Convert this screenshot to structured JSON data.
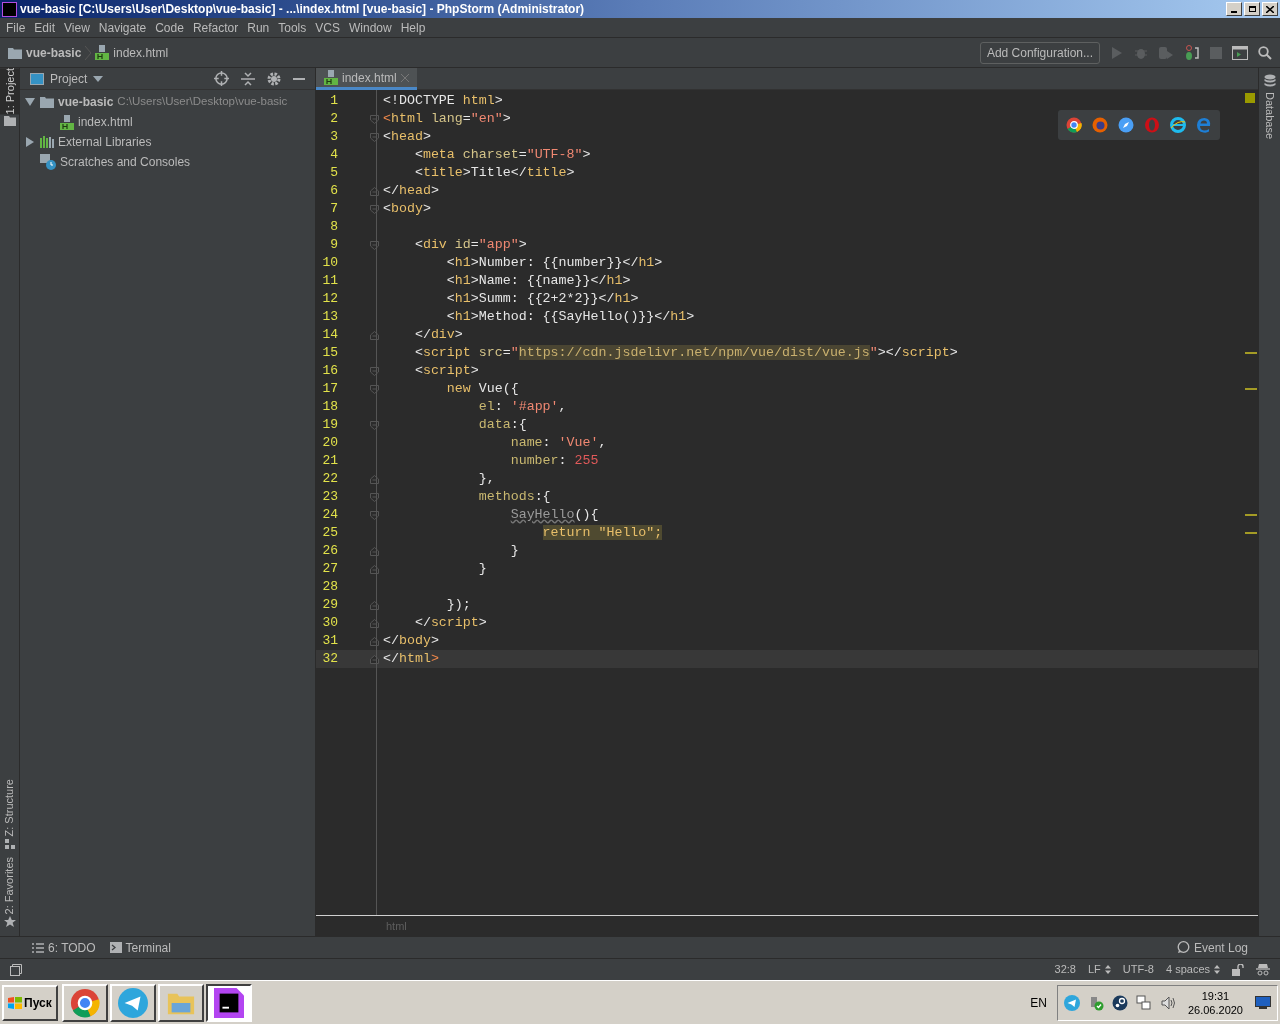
{
  "window": {
    "title": "vue-basic [C:\\Users\\User\\Desktop\\vue-basic] - ...\\index.html [vue-basic] - PhpStorm (Administrator)"
  },
  "menu": [
    "File",
    "Edit",
    "View",
    "Navigate",
    "Code",
    "Refactor",
    "Run",
    "Tools",
    "VCS",
    "Window",
    "Help"
  ],
  "navigation": {
    "breadcrumbs": [
      {
        "label": "vue-basic",
        "kind": "folder"
      },
      {
        "label": "index.html",
        "kind": "html"
      }
    ],
    "run_config": "Add Configuration..."
  },
  "left_stripe": {
    "top": [
      {
        "label": "1: Project",
        "selected": true
      }
    ],
    "bottom": [
      {
        "label": "Z: Structure",
        "selected": false
      },
      {
        "label": "2: Favorites",
        "selected": false
      }
    ]
  },
  "right_stripe": [
    {
      "label": "Database",
      "selected": false
    }
  ],
  "project": {
    "title": "Project",
    "tree": [
      {
        "label": "vue-basic",
        "path": "C:\\Users\\User\\Desktop\\vue-basic",
        "kind": "folder",
        "expanded": true,
        "children": [
          {
            "label": "index.html",
            "kind": "html"
          }
        ]
      },
      {
        "label": "External Libraries",
        "kind": "library",
        "expanded": false
      },
      {
        "label": "Scratches and Consoles",
        "kind": "scratch"
      }
    ]
  },
  "editor": {
    "tabs": [
      {
        "label": "index.html",
        "selected": true
      }
    ],
    "lines": [
      {
        "number": "1",
        "fold_open": false,
        "fold_close": false,
        "warning": false,
        "current": false,
        "tokens": [
          {
            "text": "<!DOCTYPE ",
            "kind": "plain"
          },
          {
            "text": "html",
            "kind": "tag"
          },
          {
            "text": ">",
            "kind": "plain"
          }
        ]
      },
      {
        "number": "2",
        "fold_open": true,
        "fold_close": false,
        "warning": false,
        "current": false,
        "tokens": [
          {
            "text": "<",
            "kind": "error"
          },
          {
            "text": "html",
            "kind": "tag"
          },
          {
            "text": " lang",
            "kind": "attr"
          },
          {
            "text": "=",
            "kind": "plain"
          },
          {
            "text": "\"en\"",
            "kind": "string"
          },
          {
            "text": ">",
            "kind": "plain"
          }
        ]
      },
      {
        "number": "3",
        "fold_open": true,
        "fold_close": false,
        "warning": false,
        "current": false,
        "tokens": [
          {
            "text": "<",
            "kind": "plain"
          },
          {
            "text": "head",
            "kind": "tag"
          },
          {
            "text": ">",
            "kind": "plain"
          }
        ]
      },
      {
        "number": "4",
        "fold_open": false,
        "fold_close": false,
        "warning": false,
        "current": false,
        "tokens": [
          {
            "text": "    <",
            "kind": "plain"
          },
          {
            "text": "meta",
            "kind": "tag"
          },
          {
            "text": " charset",
            "kind": "attr"
          },
          {
            "text": "=",
            "kind": "plain"
          },
          {
            "text": "\"UTF-8\"",
            "kind": "string"
          },
          {
            "text": ">",
            "kind": "plain"
          }
        ]
      },
      {
        "number": "5",
        "fold_open": false,
        "fold_close": false,
        "warning": false,
        "current": false,
        "tokens": [
          {
            "text": "    <",
            "kind": "plain"
          },
          {
            "text": "title",
            "kind": "tag"
          },
          {
            "text": ">Title</",
            "kind": "plain"
          },
          {
            "text": "title",
            "kind": "tag"
          },
          {
            "text": ">",
            "kind": "plain"
          }
        ]
      },
      {
        "number": "6",
        "fold_open": false,
        "fold_close": true,
        "warning": false,
        "current": false,
        "tokens": [
          {
            "text": "</",
            "kind": "plain"
          },
          {
            "text": "head",
            "kind": "tag"
          },
          {
            "text": ">",
            "kind": "plain"
          }
        ]
      },
      {
        "number": "7",
        "fold_open": true,
        "fold_close": false,
        "warning": false,
        "current": false,
        "tokens": [
          {
            "text": "<",
            "kind": "plain"
          },
          {
            "text": "body",
            "kind": "tag"
          },
          {
            "text": ">",
            "kind": "plain"
          }
        ]
      },
      {
        "number": "8",
        "fold_open": false,
        "fold_close": false,
        "warning": false,
        "current": false
      },
      {
        "number": "9",
        "fold_open": true,
        "fold_close": false,
        "warning": false,
        "current": false,
        "tokens": [
          {
            "text": "    <",
            "kind": "plain"
          },
          {
            "text": "div",
            "kind": "tag"
          },
          {
            "text": " id",
            "kind": "attr"
          },
          {
            "text": "=",
            "kind": "plain"
          },
          {
            "text": "\"app\"",
            "kind": "string"
          },
          {
            "text": ">",
            "kind": "plain"
          }
        ]
      },
      {
        "number": "10",
        "fold_open": false,
        "fold_close": false,
        "warning": false,
        "current": false,
        "tokens": [
          {
            "text": "        <",
            "kind": "plain"
          },
          {
            "text": "h1",
            "kind": "tag"
          },
          {
            "text": ">Number: {{number}}</",
            "kind": "plain"
          },
          {
            "text": "h1",
            "kind": "tag"
          },
          {
            "text": ">",
            "kind": "plain"
          }
        ]
      },
      {
        "number": "11",
        "fold_open": false,
        "fold_close": false,
        "warning": false,
        "current": false,
        "tokens": [
          {
            "text": "        <",
            "kind": "plain"
          },
          {
            "text": "h1",
            "kind": "tag"
          },
          {
            "text": ">Name: {{name}}</",
            "kind": "plain"
          },
          {
            "text": "h1",
            "kind": "tag"
          },
          {
            "text": ">",
            "kind": "plain"
          }
        ]
      },
      {
        "number": "12",
        "fold_open": false,
        "fold_close": false,
        "warning": false,
        "current": false,
        "tokens": [
          {
            "text": "        <",
            "kind": "plain"
          },
          {
            "text": "h1",
            "kind": "tag"
          },
          {
            "text": ">Summ: {{2+2*2}}</",
            "kind": "plain"
          },
          {
            "text": "h1",
            "kind": "tag"
          },
          {
            "text": ">",
            "kind": "plain"
          }
        ]
      },
      {
        "number": "13",
        "fold_open": false,
        "fold_close": false,
        "warning": false,
        "current": false,
        "tokens": [
          {
            "text": "        <",
            "kind": "plain"
          },
          {
            "text": "h1",
            "kind": "tag"
          },
          {
            "text": ">Method: {{SayHello()}}</",
            "kind": "plain"
          },
          {
            "text": "h1",
            "kind": "tag"
          },
          {
            "text": ">",
            "kind": "plain"
          }
        ]
      },
      {
        "number": "14",
        "fold_open": false,
        "fold_close": true,
        "warning": false,
        "current": false,
        "tokens": [
          {
            "text": "    </",
            "kind": "plain"
          },
          {
            "text": "div",
            "kind": "tag"
          },
          {
            "text": ">",
            "kind": "plain"
          }
        ]
      },
      {
        "number": "15",
        "fold_open": false,
        "fold_close": false,
        "warning": true,
        "current": false,
        "tokens": [
          {
            "text": "    <",
            "kind": "plain"
          },
          {
            "text": "script",
            "kind": "tag"
          },
          {
            "text": " src",
            "kind": "attr"
          },
          {
            "text": "=",
            "kind": "plain"
          },
          {
            "text": "\"",
            "kind": "string"
          },
          {
            "text": "https://cdn.jsdelivr.net/npm/vue/dist/vue.js",
            "kind": "url"
          },
          {
            "text": "\"",
            "kind": "string"
          },
          {
            "text": "></",
            "kind": "plain"
          },
          {
            "text": "script",
            "kind": "tag"
          },
          {
            "text": ">",
            "kind": "plain"
          }
        ]
      },
      {
        "number": "16",
        "fold_open": true,
        "fold_close": false,
        "warning": false,
        "current": false,
        "tokens": [
          {
            "text": "    <",
            "kind": "plain"
          },
          {
            "text": "script",
            "kind": "tag"
          },
          {
            "text": ">",
            "kind": "plain"
          }
        ]
      },
      {
        "number": "17",
        "fold_open": true,
        "fold_close": false,
        "warning": true,
        "current": false,
        "tokens": [
          {
            "text": "        new",
            "kind": "keyword"
          },
          {
            "text": " Vue({",
            "kind": "plain"
          }
        ]
      },
      {
        "number": "18",
        "fold_open": false,
        "fold_close": false,
        "warning": false,
        "current": false,
        "tokens": [
          {
            "text": "            el",
            "kind": "prop"
          },
          {
            "text": ": ",
            "kind": "plain"
          },
          {
            "text": "'#app'",
            "kind": "string"
          },
          {
            "text": ",",
            "kind": "plain"
          }
        ]
      },
      {
        "number": "19",
        "fold_open": true,
        "fold_close": false,
        "warning": false,
        "current": false,
        "tokens": [
          {
            "text": "            data",
            "kind": "prop"
          },
          {
            "text": ":{",
            "kind": "plain"
          }
        ]
      },
      {
        "number": "20",
        "fold_open": false,
        "fold_close": false,
        "warning": false,
        "current": false,
        "tokens": [
          {
            "text": "                name",
            "kind": "prop"
          },
          {
            "text": ": ",
            "kind": "plain"
          },
          {
            "text": "'Vue'",
            "kind": "string"
          },
          {
            "text": ",",
            "kind": "plain"
          }
        ]
      },
      {
        "number": "21",
        "fold_open": false,
        "fold_close": false,
        "warning": false,
        "current": false,
        "tokens": [
          {
            "text": "                number",
            "kind": "prop"
          },
          {
            "text": ": ",
            "kind": "plain"
          },
          {
            "text": "255",
            "kind": "number"
          }
        ]
      },
      {
        "number": "22",
        "fold_open": false,
        "fold_close": true,
        "warning": false,
        "current": false,
        "tokens": [
          {
            "text": "            },",
            "kind": "plain"
          }
        ]
      },
      {
        "number": "23",
        "fold_open": true,
        "fold_close": false,
        "warning": false,
        "current": false,
        "tokens": [
          {
            "text": "            methods",
            "kind": "prop"
          },
          {
            "text": ":{",
            "kind": "plain"
          }
        ]
      },
      {
        "number": "24",
        "fold_open": true,
        "fold_close": false,
        "warning": true,
        "current": false,
        "tokens": [
          {
            "text": "                SayHello",
            "kind": "unused"
          },
          {
            "text": "(){",
            "kind": "plain"
          }
        ]
      },
      {
        "number": "25",
        "fold_open": false,
        "fold_close": false,
        "warning": true,
        "current": false,
        "tokens": [
          {
            "text": "                    return \"Hello\";",
            "kind": "highlight"
          }
        ]
      },
      {
        "number": "26",
        "fold_open": false,
        "fold_close": true,
        "warning": false,
        "current": false,
        "tokens": [
          {
            "text": "                }",
            "kind": "plain"
          }
        ]
      },
      {
        "number": "27",
        "fold_open": false,
        "fold_close": true,
        "warning": false,
        "current": false,
        "tokens": [
          {
            "text": "            }",
            "kind": "plain"
          }
        ]
      },
      {
        "number": "28",
        "fold_open": false,
        "fold_close": false,
        "warning": false,
        "current": false
      },
      {
        "number": "29",
        "fold_open": false,
        "fold_close": true,
        "warning": false,
        "current": false,
        "tokens": [
          {
            "text": "        });",
            "kind": "plain"
          }
        ]
      },
      {
        "number": "30",
        "fold_open": false,
        "fold_close": true,
        "warning": false,
        "current": false,
        "tokens": [
          {
            "text": "    </",
            "kind": "plain"
          },
          {
            "text": "script",
            "kind": "tag"
          },
          {
            "text": ">",
            "kind": "plain"
          }
        ]
      },
      {
        "number": "31",
        "fold_open": false,
        "fold_close": true,
        "warning": false,
        "current": false,
        "tokens": [
          {
            "text": "</",
            "kind": "plain"
          },
          {
            "text": "body",
            "kind": "tag"
          },
          {
            "text": ">",
            "kind": "plain"
          }
        ]
      },
      {
        "number": "32",
        "fold_open": false,
        "fold_close": true,
        "warning": false,
        "current": true,
        "tokens": [
          {
            "text": "</",
            "kind": "plain"
          },
          {
            "text": "html",
            "kind": "tag"
          },
          {
            "text": ">",
            "kind": "error"
          }
        ]
      }
    ],
    "breadcrumb": "html"
  },
  "tool_windows": [
    {
      "label": "6: TODO",
      "kind": "todo"
    },
    {
      "label": "Terminal",
      "kind": "terminal"
    }
  ],
  "event_log": "Event Log",
  "status_bar": {
    "position": "32:8",
    "line_separator": "LF",
    "encoding": "UTF-8",
    "indent": "4 spaces"
  },
  "taskbar": {
    "start": "Пуск",
    "apps": [
      {
        "kind": "chrome",
        "selected": false
      },
      {
        "kind": "telegram",
        "selected": false
      },
      {
        "kind": "explorer",
        "selected": false
      },
      {
        "kind": "phpstorm",
        "selected": true
      }
    ],
    "language": "EN",
    "time": "19:31",
    "date": "26.06.2020"
  }
}
